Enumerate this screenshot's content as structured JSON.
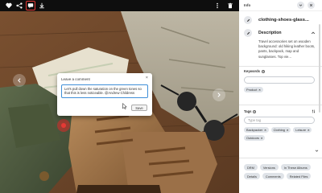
{
  "viewer": {
    "comment_box": {
      "title": "Leave a comment",
      "close": "×",
      "text": "Let's pull down the saturation on the green tones so that this is less noticeable. @Andrew Childress",
      "save_label": "Save"
    }
  },
  "panel": {
    "title": "Info",
    "filename": "clothing-shoes-glass...",
    "description_label": "Description",
    "description_text": "Travel accessories set on wooden background: old hiking leather boots, pants, backpack, map and sunglasses. Top vie...",
    "keywords_label": "Keywords",
    "keywords_help": "?",
    "keywords_placeholder": "",
    "keywords": [
      "Product"
    ],
    "tags_label": "Tags",
    "tags_help": "?",
    "tags_placeholder": "Type tag",
    "tags": [
      "Backpacker",
      "Clothing",
      "Leisure",
      "Outdoors"
    ],
    "chip_remove": "×",
    "actions": [
      "DRM",
      "Versions",
      "In These Albums",
      "Details",
      "Comments",
      "Related Files"
    ]
  }
}
